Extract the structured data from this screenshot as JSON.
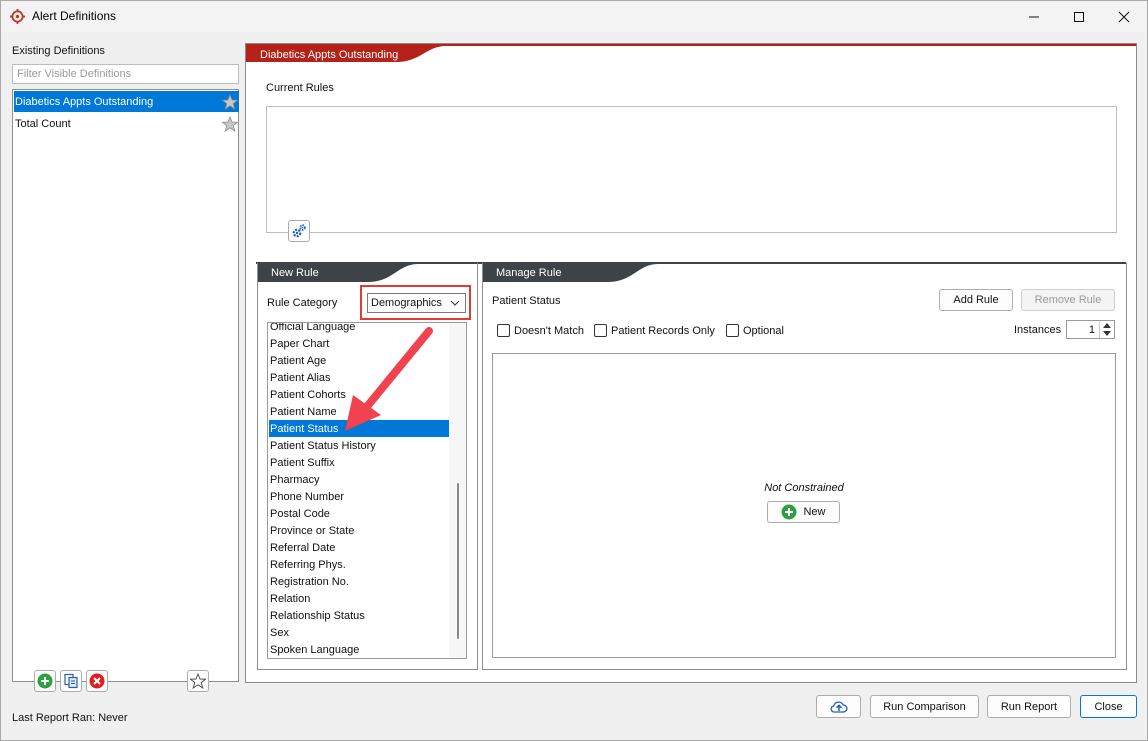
{
  "window": {
    "title": "Alert Definitions"
  },
  "left": {
    "heading": "Existing Definitions",
    "filter_placeholder": "Filter Visible Definitions",
    "definitions": [
      {
        "label": "Diabetics Appts Outstanding",
        "selected": true
      },
      {
        "label": "Total Count",
        "selected": false
      }
    ],
    "last_report": "Last Report Ran: Never"
  },
  "main": {
    "definition_title": "Diabetics Appts Outstanding",
    "current_rules_label": "Current Rules"
  },
  "new_rule": {
    "tab": "New Rule",
    "category_label": "Rule Category",
    "category_value": "Demographics",
    "items": [
      "Official Language",
      "Paper Chart",
      "Patient Age",
      "Patient Alias",
      "Patient Cohorts",
      "Patient Name",
      "Patient Status",
      "Patient Status History",
      "Patient Suffix",
      "Pharmacy",
      "Phone Number",
      "Postal Code",
      "Province or State",
      "Referral Date",
      "Referring Phys.",
      "Registration No.",
      "Relation",
      "Relationship Status",
      "Sex",
      "Spoken Language"
    ],
    "selected_item": "Patient Status"
  },
  "manage_rule": {
    "tab": "Manage Rule",
    "rule_name": "Patient Status",
    "add_rule": "Add Rule",
    "remove_rule": "Remove Rule",
    "doesnt_match": "Doesn't Match",
    "patient_records_only": "Patient Records Only",
    "optional": "Optional",
    "instances_label": "Instances",
    "instances_value": "1",
    "not_constrained": "Not Constrained",
    "new_button": "New"
  },
  "footer": {
    "run_comparison": "Run Comparison",
    "run_report": "Run Report",
    "close": "Close"
  },
  "colors": {
    "accent_red": "#b4221a",
    "dark_tab": "#3d4347",
    "selection_blue": "#0078d7",
    "highlight_border": "#e53935",
    "arrow": "#f0424f"
  },
  "icons": {
    "app": "target-icon",
    "gear": "gears-icon",
    "add": "plus-circle-icon",
    "copy": "copy-icon",
    "delete": "x-circle-icon",
    "favorite": "star-icon",
    "upload": "cloud-upload-icon"
  }
}
